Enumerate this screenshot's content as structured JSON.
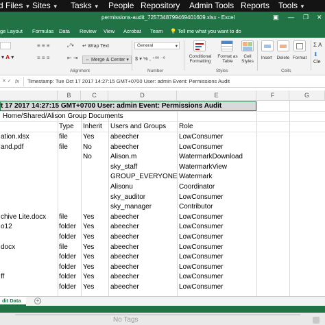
{
  "topnav": {
    "items": [
      {
        "label": "d Files",
        "caret": "▼"
      },
      {
        "label": "Sites",
        "caret": "▼"
      },
      {
        "label": "Tasks",
        "caret": "▼"
      },
      {
        "label": "People"
      },
      {
        "label": "Repository"
      },
      {
        "label": "Admin Tools"
      },
      {
        "label": "Reports"
      },
      {
        "label": "Tools",
        "caret": "▼"
      }
    ]
  },
  "titlebar": {
    "title": "permissions-audit_7257348799469401609.xlsx  -  Excel"
  },
  "menubar": {
    "tabs": [
      "ge Layout",
      "Formulas",
      "Data",
      "Review",
      "View",
      "Acrobat",
      "Team"
    ],
    "tell_me": "Tell me what you want to do"
  },
  "ribbon": {
    "wrap_text": "Wrap Text",
    "merge_center": "Merge & Center",
    "number_format": "General",
    "alignment_group": "Alignment",
    "number_group": "Number",
    "styles_group": "Styles",
    "cells_group": "Cells",
    "conditional_formatting": "Conditional Formatting",
    "format_as_table": "Format as Table",
    "cell_styles": "Cell Styles",
    "insert": "Insert",
    "delete": "Delete",
    "format": "Format",
    "editing_partial": "Cle"
  },
  "formulabar": {
    "content": "Timestamp: Tue Oct 17 2017 14:27:15 GMT+0700 User: admin Event: Permissions Audit"
  },
  "columns": [
    "B",
    "C",
    "D",
    "E",
    "F",
    "G"
  ],
  "grid": {
    "banner": "t 17 2017 14:27:15 GMT+0700 User: admin Event: Permissions Audit",
    "path": "Home/Shared/Alison Group Documents",
    "headers": {
      "type": "Type",
      "inherit": "Inherit",
      "users": "Users and Groups",
      "role": "Role"
    },
    "rows": [
      {
        "name": "ation.xlsx",
        "type": "file",
        "inherit": "Yes",
        "user": "abeecher",
        "role": "LowConsumer"
      },
      {
        "name": "and.pdf",
        "type": "file",
        "inherit": "No",
        "user": "abeecher",
        "role": "LowConsumer"
      },
      {
        "name": "",
        "type": "",
        "inherit": "No",
        "user": "Alison.m",
        "role": "WatermarkDownload"
      },
      {
        "name": "",
        "type": "",
        "inherit": "",
        "user": "sky_staff",
        "role": "WatermarkView"
      },
      {
        "name": "",
        "type": "",
        "inherit": "",
        "user": "GROUP_EVERYONE",
        "role": "Watermark"
      },
      {
        "name": "",
        "type": "",
        "inherit": "",
        "user": "Alisonu",
        "role": "Coordinator"
      },
      {
        "name": "",
        "type": "",
        "inherit": "",
        "user": "sky_auditor",
        "role": "LowConsumer"
      },
      {
        "name": "",
        "type": "",
        "inherit": "",
        "user": "sky_manager",
        "role": "Contributor"
      },
      {
        "name": "chive Lite.docx",
        "type": "file",
        "inherit": "Yes",
        "user": "abeecher",
        "role": "LowConsumer"
      },
      {
        "name": "o12",
        "type": "folder",
        "inherit": "Yes",
        "user": "abeecher",
        "role": "LowConsumer"
      },
      {
        "name": "",
        "type": "folder",
        "inherit": "Yes",
        "user": "abeecher",
        "role": "LowConsumer"
      },
      {
        "name": "docx",
        "type": "file",
        "inherit": "Yes",
        "user": "abeecher",
        "role": "LowConsumer"
      },
      {
        "name": "",
        "type": "folder",
        "inherit": "Yes",
        "user": "abeecher",
        "role": "LowConsumer"
      },
      {
        "name": "",
        "type": "folder",
        "inherit": "Yes",
        "user": "abeecher",
        "role": "LowConsumer"
      },
      {
        "name": "ff",
        "type": "folder",
        "inherit": "Yes",
        "user": "abeecher",
        "role": "LowConsumer"
      },
      {
        "name": "",
        "type": "folder",
        "inherit": "Yes",
        "user": "abeecher",
        "role": "LowConsumer"
      }
    ]
  },
  "sheet_tab": "dit Data",
  "add_sheet": "+",
  "bottom": {
    "tags": "No Tags"
  }
}
